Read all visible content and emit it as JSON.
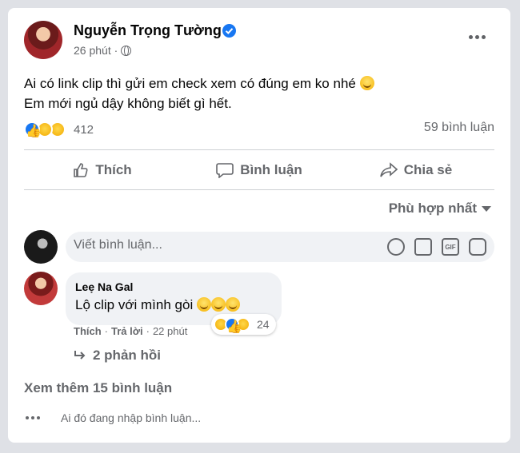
{
  "post": {
    "author": "Nguyễn Trọng Tường",
    "time": "26 phút ·",
    "text_line1": "Ai có link clip thì gửi em check xem có đúng em ko nhé",
    "text_line2": "Em mới ngủ dậy không biết gì hết.",
    "reaction_count": "412",
    "comment_count": "59 bình luận"
  },
  "actions": {
    "like": "Thích",
    "comment": "Bình luận",
    "share": "Chia sẻ"
  },
  "sort_label": "Phù hợp nhất",
  "comment_input": {
    "placeholder": "Viết bình luận..."
  },
  "comment": {
    "name": "Leẹ Na Gal",
    "text": "Lộ clip với mình gòi",
    "reaction_count": "24",
    "like": "Thích",
    "reply": "Trả lời",
    "time": "22 phút",
    "replies": "2 phản hồi"
  },
  "see_more": "Xem thêm 15 bình luận",
  "typing": "Ai đó đang nhập bình luận...",
  "icons": [
    "verified-icon",
    "globe-icon",
    "more-icon",
    "like-icon",
    "comment-icon",
    "share-icon",
    "caret-icon",
    "smile-icon",
    "camera-icon",
    "gif-icon",
    "sticker-icon",
    "reply-arrow-icon"
  ],
  "colors": {
    "accent": "#1877f2",
    "secondary_text": "#65676b",
    "bubble": "#f0f2f5"
  }
}
